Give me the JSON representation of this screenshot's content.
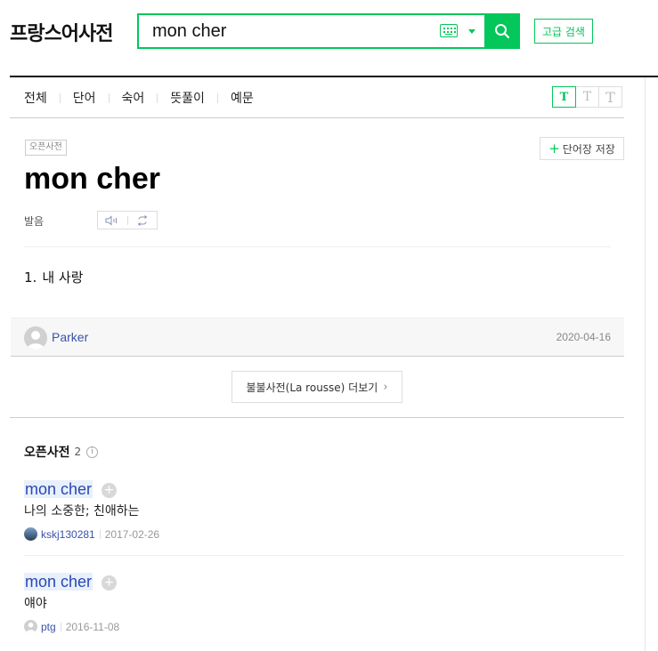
{
  "header": {
    "logo": "프랑스어사전",
    "search_value": "mon cher",
    "advanced_search": "고급 검색"
  },
  "tabs": [
    "전체",
    "단어",
    "숙어",
    "뜻풀이",
    "예문"
  ],
  "font_size_buttons": [
    "T",
    "T",
    "T"
  ],
  "entry": {
    "badge": "오픈사전",
    "wordbook_label": "단어장 저장",
    "headword": "mon cher",
    "pronunciation_label": "발음",
    "meaning_number": "1.",
    "meaning_text": "내 사랑",
    "author": "Parker",
    "date": "2020-04-16"
  },
  "more_button": "불불사전(La rousse) 더보기",
  "open_dictionary": {
    "title": "오픈사전",
    "count": "2",
    "info_icon": "i",
    "items": [
      {
        "word": "mon cher",
        "definition": "나의 소중한; 친애하는",
        "user": "kskj130281",
        "date": "2017-02-26"
      },
      {
        "word": "mon cher",
        "definition": "얘야",
        "user": "ptg",
        "date": "2016-11-08"
      }
    ]
  },
  "colors": {
    "accent": "#03c75a",
    "link": "#3a52a8",
    "headword_highlight": "#e8f0fb"
  }
}
